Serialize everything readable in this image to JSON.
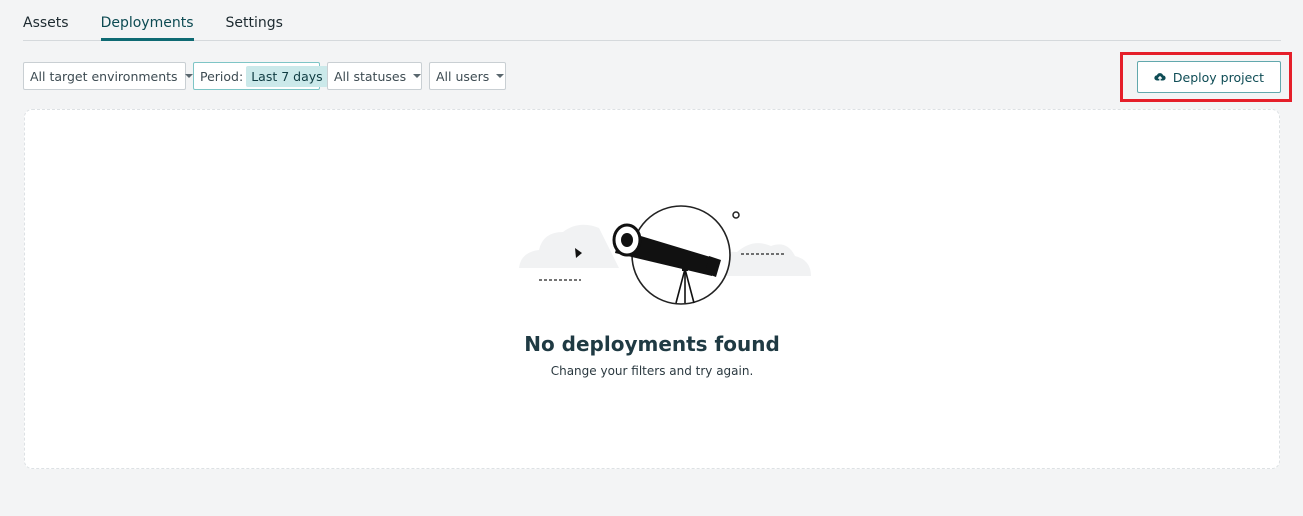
{
  "tabs": [
    {
      "label": "Assets",
      "active": false
    },
    {
      "label": "Deployments",
      "active": true
    },
    {
      "label": "Settings",
      "active": false
    }
  ],
  "filters": {
    "environment": "All target environments",
    "period_label": "Period:",
    "period_value": "Last 7 days",
    "status": "All statuses",
    "users": "All users"
  },
  "actions": {
    "deploy_label": "Deploy project",
    "deploy_icon": "cloud-upload-icon"
  },
  "empty_state": {
    "title": "No deployments found",
    "subtitle": "Change your filters and try again.",
    "illustration": "telescope-icon"
  },
  "colors": {
    "accent": "#0e6a73",
    "period_chip_bg": "#cbe9ea",
    "highlight": "#e51f2a"
  }
}
